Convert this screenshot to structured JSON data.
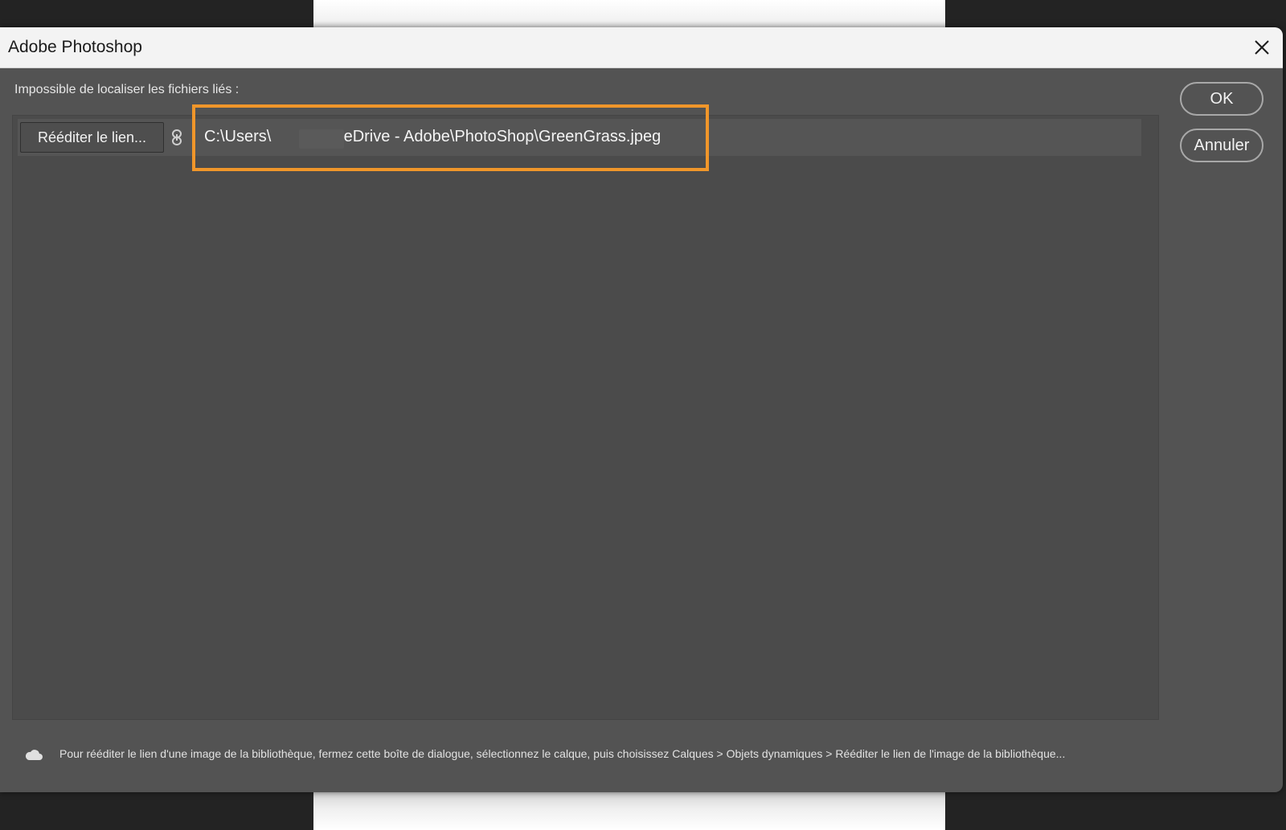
{
  "window": {
    "title": "Adobe Photoshop"
  },
  "dialog": {
    "label": "Impossible de localiser les fichiers liés :",
    "items": [
      {
        "relink_label": "Rééditer le lien...",
        "path_prefix": "C:\\Users\\",
        "path_suffix": "\\OneDrive - Adobe\\PhotoShop\\GreenGrass.jpeg"
      }
    ],
    "buttons": {
      "ok": "OK",
      "cancel": "Annuler"
    },
    "footer_note": "Pour rééditer le lien d'une image de la bibliothèque, fermez cette boîte de dialogue, sélectionnez le calque, puis choisissez Calques > Objets dynamiques > Rééditer le lien de l'image de la bibliothèque..."
  },
  "icons": {
    "close": "close-icon",
    "link": "link-icon",
    "cloud": "cloud-icon"
  },
  "colors": {
    "highlight": "#f0962a",
    "dialog_bg": "#535353",
    "panel_bg": "#4b4b4b"
  }
}
